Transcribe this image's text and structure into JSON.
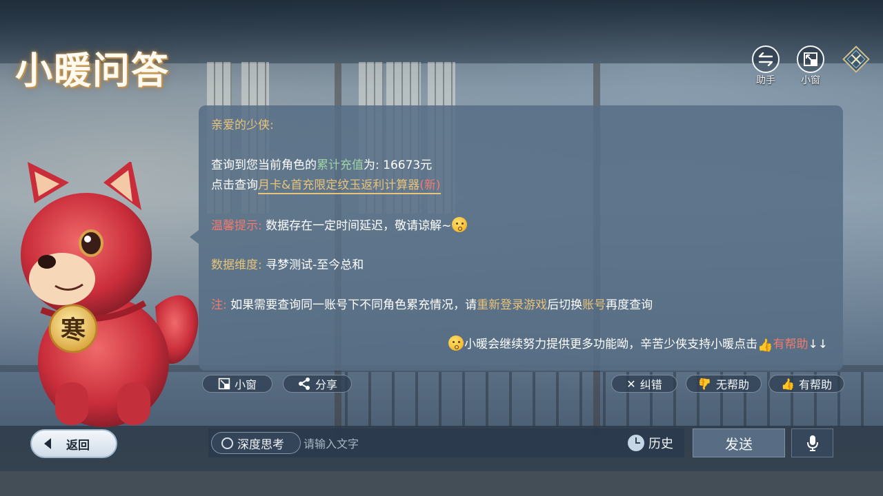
{
  "header": {
    "title": "小暖问答",
    "assistant_label": "助手",
    "small_window_label": "小窗"
  },
  "message": {
    "greeting": "亲爱的少侠:",
    "query_prefix": "查询到您当前角色的",
    "query_highlight": "累计充值",
    "query_suffix": "为: 16673元",
    "click_prefix": "点击查询",
    "calculator_link": "月卡&首充限定纹玉返利计算器",
    "calculator_new": "(新)",
    "tip_label": "温馨提示:",
    "tip_text": "数据存在一定时间延迟，敬请谅解~",
    "dimension_label": "数据维度:",
    "dimension_value": "寻梦测试-至今总和",
    "note_label": "注:",
    "note_text_1": "如果需要查询同一账号下不同角色累充情况，请",
    "note_highlight_1": "重新登录游戏",
    "note_text_2": "后切换",
    "note_highlight_2": "账号",
    "note_text_3": "再度查询",
    "footer_text": "小暖会继续努力提供更多功能呦，辛苦少侠支持小暖点击",
    "footer_helpful": "有帮助",
    "footer_arrows": "↓↓"
  },
  "panel_actions": {
    "small_window": "小窗",
    "share": "分享",
    "correct": "纠错",
    "not_helpful": "无帮助",
    "helpful": "有帮助"
  },
  "input_bar": {
    "back": "返回",
    "deep_think": "深度思考",
    "placeholder": "请输入文字",
    "history": "历史",
    "send": "发送"
  },
  "mascot": {
    "tag_char": "寒"
  },
  "colors": {
    "gold": "#e8c37a",
    "green": "#9fd3a6",
    "red": "#f17b6e",
    "panel": "#566d85"
  }
}
